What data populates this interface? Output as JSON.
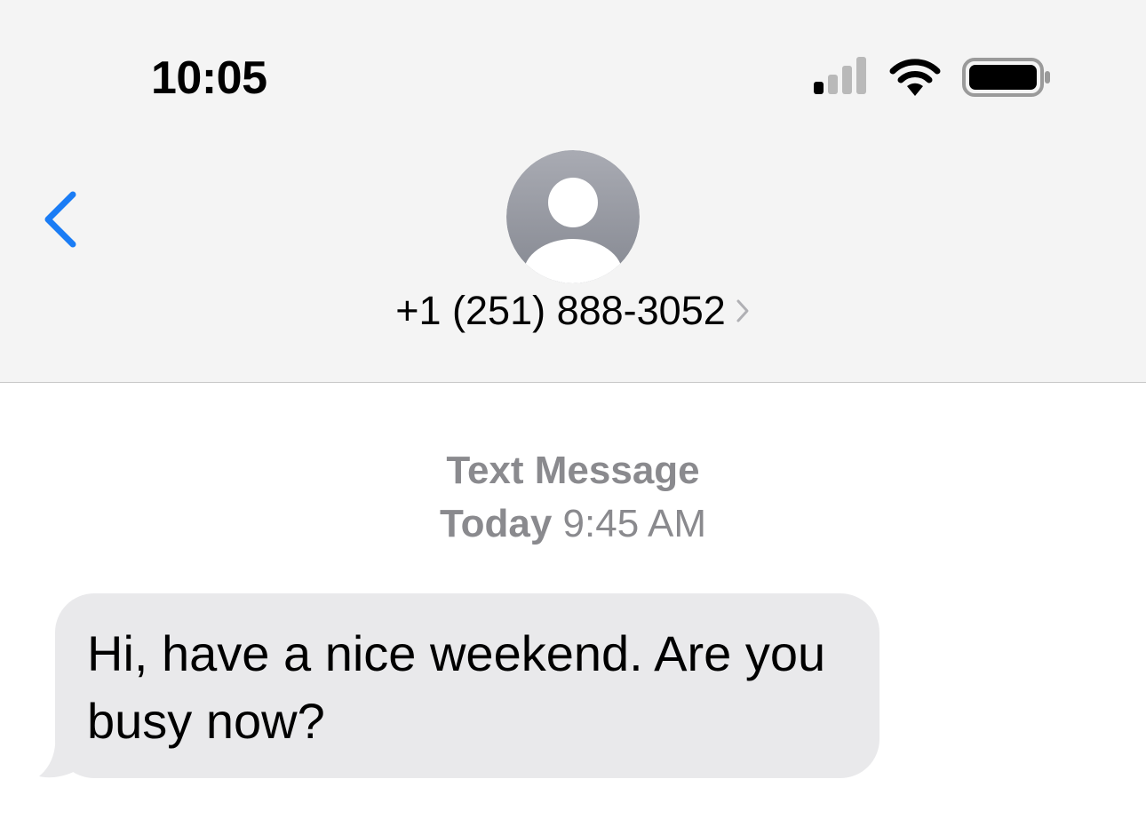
{
  "status_bar": {
    "time": "10:05",
    "icons": [
      "cellular-signal-icon",
      "wifi-icon",
      "battery-icon"
    ]
  },
  "nav": {
    "back_icon": "chevron-left-icon",
    "avatar_icon": "person-placeholder-icon",
    "contact_number": "+1 (251) 888-3052",
    "contact_chevron_icon": "chevron-right-icon"
  },
  "conversation": {
    "service_label": "Text Message",
    "timestamp_day": "Today",
    "timestamp_time": "9:45 AM",
    "messages": [
      {
        "direction": "incoming",
        "text": "Hi, have a nice weekend. Are you busy now?"
      }
    ]
  },
  "colors": {
    "header_bg": "#f4f4f4",
    "accent_blue": "#1a7cf5",
    "incoming_bubble": "#e9e9eb",
    "meta_gray": "#8a8a8e",
    "avatar_gray": "#a0a2aa"
  }
}
